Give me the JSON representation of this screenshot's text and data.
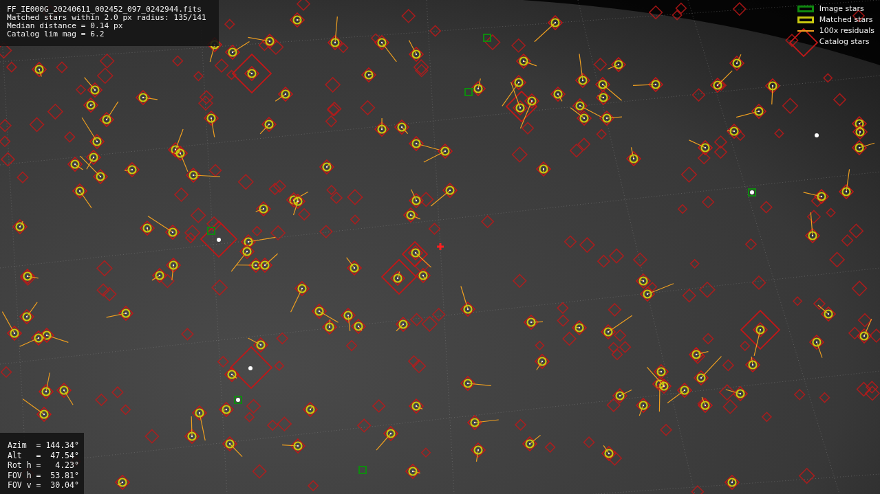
{
  "info_box": {
    "lines": [
      "FF_IE000G_20240611_002452_097_0242944.fits",
      "Matched stars within 2.0 px radius: 135/141",
      "Median distance = 0.14 px",
      "Catalog lim mag = 6.2"
    ]
  },
  "pointing_box": {
    "lines": [
      "Azim  = 144.34°",
      "Alt   =  47.54°",
      "Rot h =   4.23°",
      "FOV h =  53.81°",
      "FOV v =  30.04°"
    ]
  },
  "legend": [
    {
      "kind": "box",
      "label": "Image stars",
      "color": "#0f8a0f"
    },
    {
      "kind": "box",
      "label": "Matched stars",
      "color": "#c8c810"
    },
    {
      "kind": "line",
      "label": "100x residuals",
      "color": "#f0a020"
    },
    {
      "kind": "none",
      "label": "Catalog stars"
    }
  ]
}
